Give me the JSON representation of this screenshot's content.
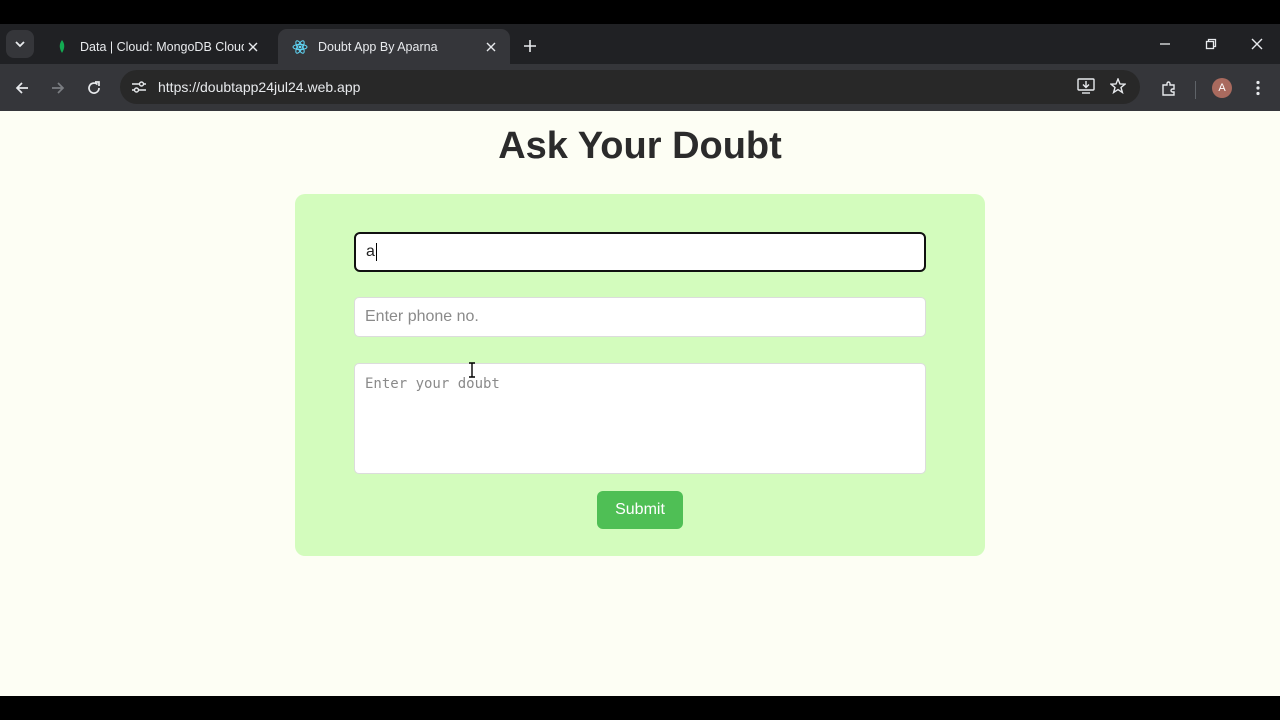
{
  "browser": {
    "tabs": [
      {
        "title": "Data | Cloud: MongoDB Cloud",
        "favicon": "mongodb-leaf-icon",
        "active": false
      },
      {
        "title": "Doubt App By Aparna",
        "favicon": "react-atom-icon",
        "active": true
      }
    ],
    "url": "https://doubtapp24jul24.web.app",
    "profile_initial": "A"
  },
  "page": {
    "title": "Ask Your Doubt",
    "form": {
      "name_value": "a",
      "phone_placeholder": "Enter phone no.",
      "doubt_placeholder": "Enter your doubt",
      "submit_label": "Submit"
    }
  },
  "colors": {
    "card_bg": "#d3fcbd",
    "submit_bg": "#4fbf55",
    "page_bg": "#fdfef4"
  }
}
